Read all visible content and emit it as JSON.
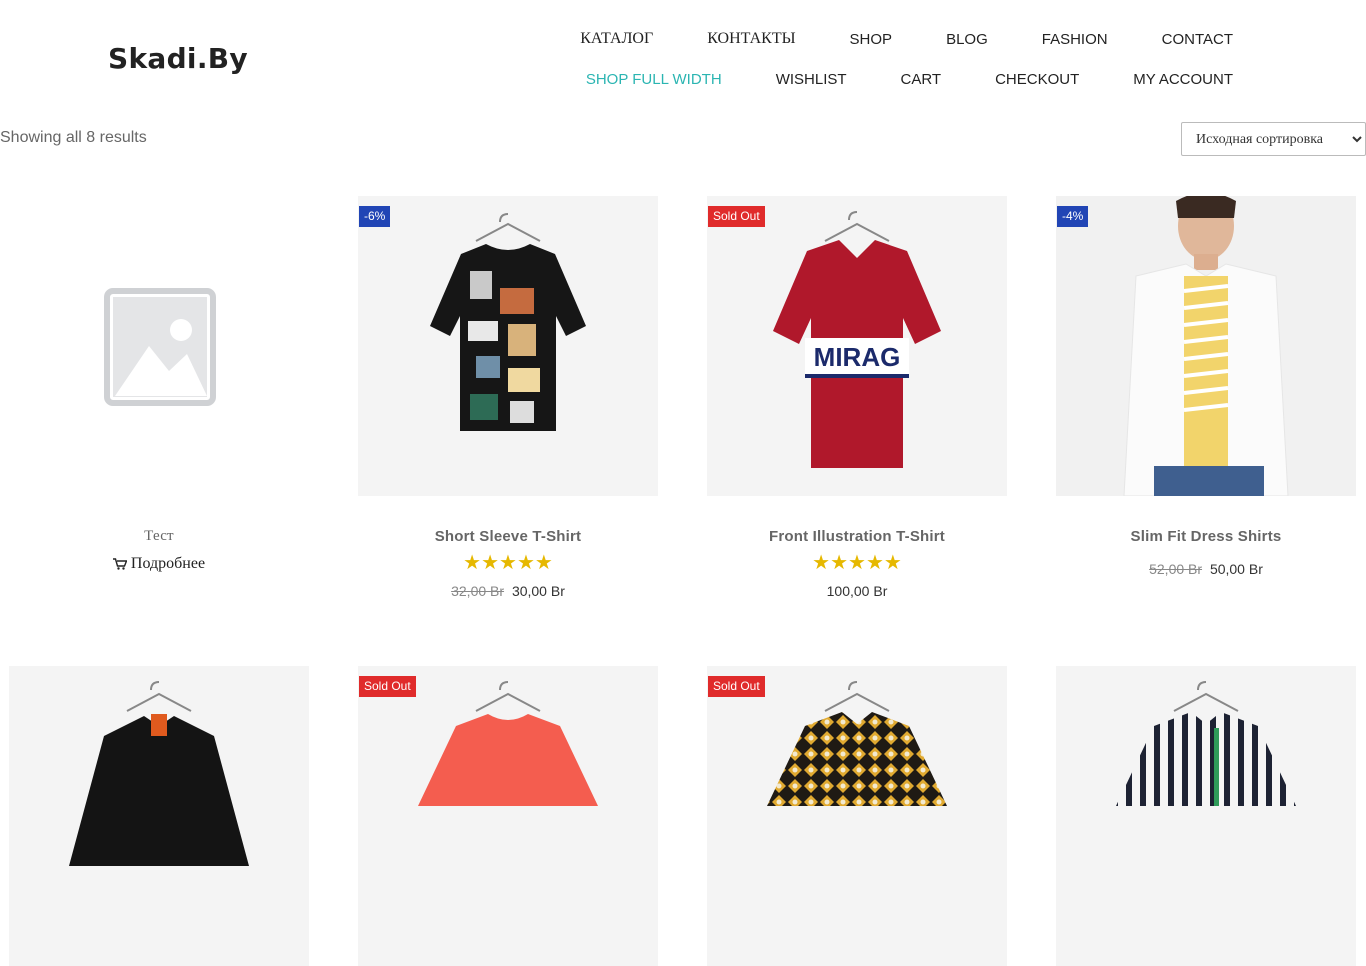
{
  "header": {
    "logo": "Skadi.By",
    "nav_row1": [
      "КАТАЛОГ",
      "КОНТАКТЫ",
      "SHOP",
      "BLOG",
      "FASHION",
      "CONTACT"
    ],
    "nav_row2": [
      "SHOP FULL WIDTH",
      "WISHLIST",
      "CART",
      "CHECKOUT",
      "MY ACCOUNT"
    ],
    "active_item": "SHOP FULL WIDTH",
    "accent_color": "#2bb5b2"
  },
  "toolbar": {
    "result_count": "Showing all 8 results",
    "sort_selected": "Исходная сортировка"
  },
  "products": [
    {
      "title": "Тест",
      "badge": "",
      "price": "",
      "old_price": "",
      "rating": 0,
      "button": "Подробнее",
      "image": "placeholder-image"
    },
    {
      "title": "Short Sleeve T-Shirt",
      "badge": "-6%",
      "price": "30,00 Br",
      "old_price": "32,00 Br",
      "rating": 5,
      "image": "graphic-print-tshirt"
    },
    {
      "title": "Front Illustration T-Shirt",
      "badge": "Sold Out",
      "price": "100,00 Br",
      "old_price": "",
      "rating": 5,
      "image": "red-polo-shirt"
    },
    {
      "title": "Slim Fit Dress Shirts",
      "badge": "-4%",
      "price": "50,00 Br",
      "old_price": "52,00 Br",
      "rating": 0,
      "image": "white-dress-shirt-model"
    },
    {
      "title": "",
      "badge": "",
      "image": "black-bomber-jacket"
    },
    {
      "title": "",
      "badge": "Sold Out",
      "image": "coral-tshirt"
    },
    {
      "title": "",
      "badge": "Sold Out",
      "image": "patterned-shirt"
    },
    {
      "title": "",
      "badge": "",
      "image": "striped-shirt"
    }
  ],
  "icons": {
    "cart": "cart-icon",
    "star": "star-icon"
  },
  "colors": {
    "sale_badge": "#2145b5",
    "soldout_badge": "#e02b2b",
    "stars": "#e6b800"
  }
}
